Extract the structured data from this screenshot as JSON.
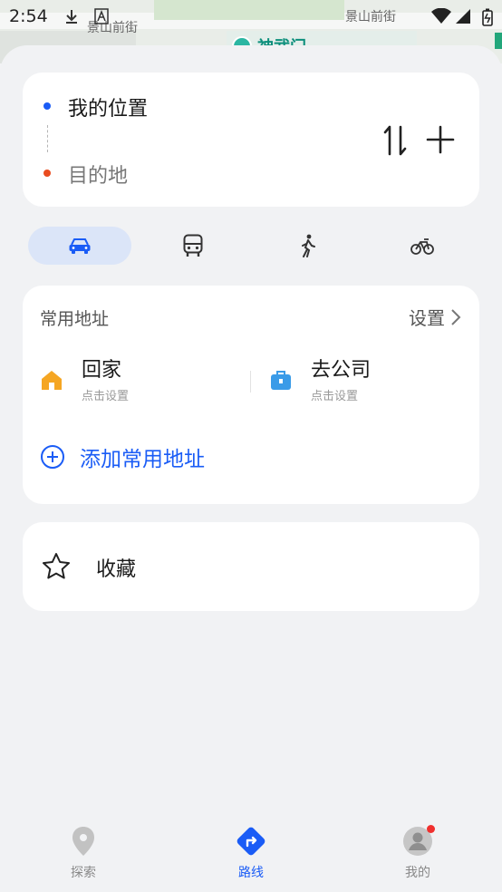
{
  "status_bar": {
    "time": "2:54"
  },
  "map": {
    "street_left": "景山前街",
    "street_right": "景山前街",
    "poi": "神武门"
  },
  "route": {
    "origin": "我的位置",
    "destination": "目的地"
  },
  "modes": [
    {
      "name": "car",
      "active": true
    },
    {
      "name": "bus",
      "active": false
    },
    {
      "name": "walk",
      "active": false
    },
    {
      "name": "bike",
      "active": false
    }
  ],
  "common_address": {
    "title": "常用地址",
    "setting_label": "设置",
    "home": {
      "label": "回家",
      "hint": "点击设置"
    },
    "work": {
      "label": "去公司",
      "hint": "点击设置"
    },
    "add_label": "添加常用地址"
  },
  "favorites": {
    "label": "收藏"
  },
  "bottom_nav": {
    "tabs": [
      {
        "label": "探索",
        "icon": "location-pin-icon"
      },
      {
        "label": "路线",
        "icon": "route-diamond-icon",
        "active": true
      },
      {
        "label": "我的",
        "icon": "avatar-icon"
      }
    ]
  },
  "colors": {
    "accent": "#1a5cf6",
    "origin_dot": "#1a5cf6",
    "dest_dot": "#e94c1f",
    "home_icon": "#f5a623",
    "work_icon": "#3a9be8"
  }
}
